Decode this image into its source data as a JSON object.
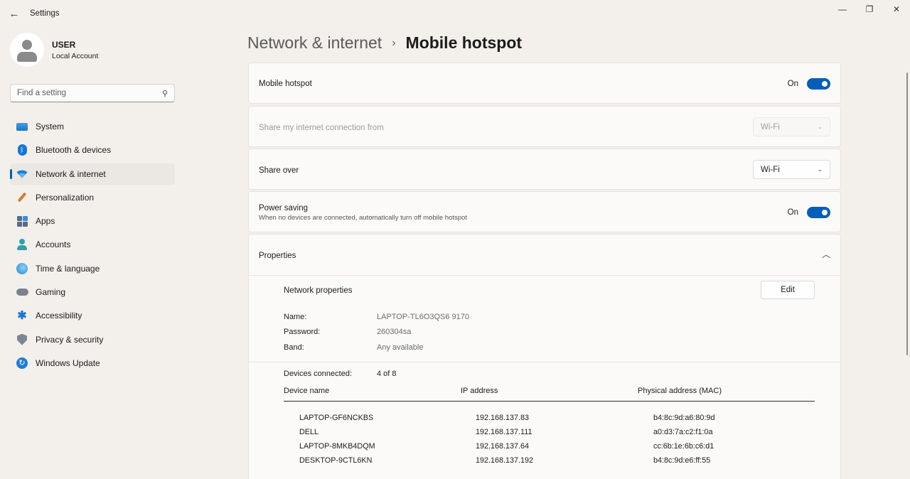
{
  "window": {
    "title": "Settings",
    "controls": {
      "minimize": "—",
      "restore": "❐",
      "close": "✕"
    }
  },
  "profile": {
    "name": "USER",
    "account_type": "Local Account"
  },
  "search": {
    "placeholder": "Find a setting"
  },
  "sidebar": {
    "items": [
      {
        "label": "System",
        "icon": "system-icon"
      },
      {
        "label": "Bluetooth & devices",
        "icon": "bluetooth-icon"
      },
      {
        "label": "Network & internet",
        "icon": "network-icon",
        "active": true
      },
      {
        "label": "Personalization",
        "icon": "brush-icon"
      },
      {
        "label": "Apps",
        "icon": "apps-icon"
      },
      {
        "label": "Accounts",
        "icon": "accounts-icon"
      },
      {
        "label": "Time & language",
        "icon": "globe-icon"
      },
      {
        "label": "Gaming",
        "icon": "gamepad-icon"
      },
      {
        "label": "Accessibility",
        "icon": "accessibility-icon"
      },
      {
        "label": "Privacy & security",
        "icon": "shield-icon"
      },
      {
        "label": "Windows Update",
        "icon": "update-icon"
      }
    ]
  },
  "breadcrumb": {
    "parent": "Network & internet",
    "separator": "›",
    "current": "Mobile hotspot"
  },
  "hotspot": {
    "label": "Mobile hotspot",
    "state": "On"
  },
  "share_from": {
    "label": "Share my internet connection from",
    "value": "Wi-Fi"
  },
  "share_over": {
    "label": "Share over",
    "value": "Wi-Fi"
  },
  "power_saving": {
    "label": "Power saving",
    "description": "When no devices are connected, automatically turn off mobile hotspot",
    "state": "On"
  },
  "properties": {
    "title": "Properties",
    "network_properties_label": "Network properties",
    "edit_label": "Edit",
    "name_key": "Name:",
    "name_value": "LAPTOP-TL6O3QS6 9170",
    "password_key": "Password:",
    "password_value": "260304sa",
    "band_key": "Band:",
    "band_value": "Any available"
  },
  "devices": {
    "connected_key": "Devices connected:",
    "connected_value": "4 of 8",
    "columns": [
      "Device name",
      "IP address",
      "Physical address (MAC)"
    ],
    "rows": [
      [
        "LAPTOP-GF6NCKBS",
        "192.168.137.83",
        "b4:8c:9d:a6:80:9d"
      ],
      [
        "DELL",
        "192.168.137.111",
        "a0:d3:7a:c2:f1:0a"
      ],
      [
        "LAPTOP-8MKB4DQM",
        "192.168.137.64",
        "cc:6b:1e:6b:c6:d1"
      ],
      [
        "DESKTOP-9CTL6KN",
        "192.168.137.192",
        "b4:8c:9d:e6:ff:55"
      ]
    ]
  },
  "colors": {
    "accent": "#005fb8",
    "background": "#f3efea",
    "card": "#fbfaf9"
  }
}
